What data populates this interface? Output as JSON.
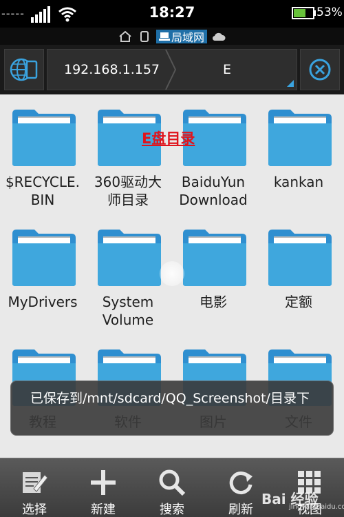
{
  "status_bar": {
    "left_indicator": "-----",
    "time": "18:27",
    "battery_percent": "53%"
  },
  "nav_strip": {
    "active_tab": "局域网"
  },
  "toolbar": {
    "host": "192.168.1.157",
    "folder": "E"
  },
  "overlay_title": "E盘目录",
  "folders": [
    {
      "label": "$RECYCLE.\nBIN"
    },
    {
      "label": "360驱动大\n师目录"
    },
    {
      "label": "BaiduYun\nDownload"
    },
    {
      "label": "kankan"
    },
    {
      "label": "MyDrivers"
    },
    {
      "label": "System\nVolume"
    },
    {
      "label": "电影"
    },
    {
      "label": "定额"
    },
    {
      "label": "教程"
    },
    {
      "label": "软件"
    },
    {
      "label": "图片"
    },
    {
      "label": "文件"
    }
  ],
  "toast": {
    "message": "已保存到/mnt/sdcard/QQ_Screenshot/目录下"
  },
  "bottom_bar": {
    "select": "选择",
    "new": "新建",
    "search": "搜索",
    "refresh": "刷新",
    "view": "视图"
  },
  "watermark": {
    "text": "Bai 经验",
    "sub": "jingyan.baidu.com"
  },
  "colors": {
    "folder": "#3fa7dd",
    "accent": "#2f8fd0",
    "overlay": "#e0141c"
  }
}
